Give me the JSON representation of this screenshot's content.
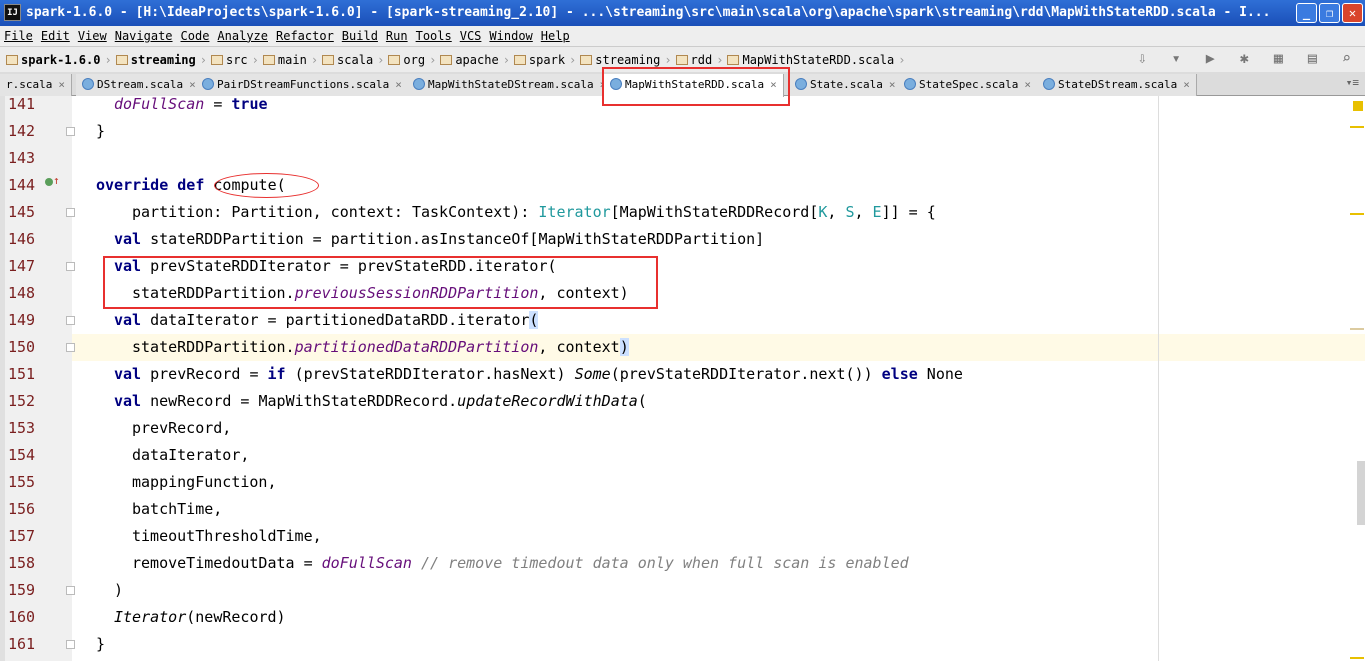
{
  "window": {
    "title": "spark-1.6.0 - [H:\\IdeaProjects\\spark-1.6.0] - [spark-streaming_2.10] - ...\\streaming\\src\\main\\scala\\org\\apache\\spark\\streaming\\rdd\\MapWithStateRDD.scala - I...",
    "app_icon": "IJ",
    "minimize": "_",
    "restore": "❐",
    "close": "✕"
  },
  "menu": [
    "File",
    "Edit",
    "View",
    "Navigate",
    "Code",
    "Analyze",
    "Refactor",
    "Build",
    "Run",
    "Tools",
    "VCS",
    "Window",
    "Help"
  ],
  "breadcrumb": [
    "spark-1.6.0",
    "streaming",
    "src",
    "main",
    "scala",
    "org",
    "apache",
    "spark",
    "streaming",
    "rdd",
    "MapWithStateRDD.scala"
  ],
  "toolbar_icons": [
    "make-icon",
    "run-config-dropdown-icon",
    "run-icon",
    "debug-icon",
    "coverage-icon",
    "project-structure-icon",
    "search-icon"
  ],
  "toolbar_glyphs": "⇩ ▾ ▶ ✱ ▦ ▤ ⌕",
  "tabs": [
    {
      "label": "r.scala",
      "active": false
    },
    {
      "label": "DStream.scala",
      "active": false
    },
    {
      "label": "PairDStreamFunctions.scala",
      "active": false
    },
    {
      "label": "MapWithStateDStream.scala",
      "active": false
    },
    {
      "label": "MapWithStateRDD.scala",
      "active": true
    },
    {
      "label": "State.scala",
      "active": false
    },
    {
      "label": "StateSpec.scala",
      "active": false
    },
    {
      "label": "StateDStream.scala",
      "active": false
    }
  ],
  "tab_close": "×",
  "tab_overflow": "▾≡",
  "current_line": 150,
  "code": [
    {
      "n": "141",
      "ind": 2,
      "tok": [
        [
          "doFullScan",
          "f"
        ],
        [
          " = ",
          ""
        ],
        [
          "true",
          "k"
        ]
      ]
    },
    {
      "n": "142",
      "ind": 0,
      "tok": [
        [
          "}",
          ""
        ]
      ]
    },
    {
      "n": "143",
      "ind": 0,
      "tok": []
    },
    {
      "n": "144",
      "ind": 0,
      "tok": [
        [
          "override def",
          "k"
        ],
        [
          " compute(",
          ""
        ]
      ]
    },
    {
      "n": "145",
      "ind": 4,
      "tok": [
        [
          "partition: Partition, context: TaskContext): ",
          ""
        ],
        [
          "Iterator",
          "t"
        ],
        [
          "[MapWithStateRDDRecord[",
          ""
        ],
        [
          "K",
          "t"
        ],
        [
          ", ",
          ""
        ],
        [
          "S",
          "t"
        ],
        [
          ", ",
          ""
        ],
        [
          "E",
          "t"
        ],
        [
          "]] = {",
          ""
        ]
      ]
    },
    {
      "n": "146",
      "ind": 2,
      "tok": [
        [
          "val",
          "k"
        ],
        [
          " stateRDDPartition = partition.asInstanceOf[MapWithStateRDDPartition]",
          ""
        ]
      ]
    },
    {
      "n": "147",
      "ind": 2,
      "tok": [
        [
          "val",
          "k"
        ],
        [
          " prevStateRDDIterator = prevStateRDD.iterator(",
          ""
        ]
      ]
    },
    {
      "n": "148",
      "ind": 4,
      "tok": [
        [
          "stateRDDPartition.",
          ""
        ],
        [
          "previousSessionRDDPartition",
          "f"
        ],
        [
          ", context)",
          ""
        ]
      ]
    },
    {
      "n": "149",
      "ind": 2,
      "tok": [
        [
          "val",
          "k"
        ],
        [
          " dataIterator = partitionedDataRDD.iterator",
          ""
        ],
        [
          "(",
          "bm"
        ]
      ]
    },
    {
      "n": "150",
      "ind": 4,
      "tok": [
        [
          "stateRDDPartition.",
          ""
        ],
        [
          "partitionedDataRDDPartition",
          "f"
        ],
        [
          ", context",
          ""
        ],
        [
          ")",
          "bm"
        ]
      ]
    },
    {
      "n": "151",
      "ind": 2,
      "tok": [
        [
          "val",
          "k"
        ],
        [
          " prevRecord = ",
          ""
        ],
        [
          "if",
          "k"
        ],
        [
          " (prevStateRDDIterator.hasNext) ",
          ""
        ],
        [
          "Some",
          "i"
        ],
        [
          "(prevStateRDDIterator.next()) ",
          ""
        ],
        [
          "else",
          "k"
        ],
        [
          " None",
          ""
        ]
      ]
    },
    {
      "n": "152",
      "ind": 2,
      "tok": [
        [
          "val",
          "k"
        ],
        [
          " newRecord = MapWithStateRDDRecord.",
          ""
        ],
        [
          "updateRecordWithData",
          "i"
        ],
        [
          "(",
          ""
        ]
      ]
    },
    {
      "n": "153",
      "ind": 4,
      "tok": [
        [
          "prevRecord,",
          ""
        ]
      ]
    },
    {
      "n": "154",
      "ind": 4,
      "tok": [
        [
          "dataIterator,",
          ""
        ]
      ]
    },
    {
      "n": "155",
      "ind": 4,
      "tok": [
        [
          "mappingFunction,",
          ""
        ]
      ]
    },
    {
      "n": "156",
      "ind": 4,
      "tok": [
        [
          "batchTime,",
          ""
        ]
      ]
    },
    {
      "n": "157",
      "ind": 4,
      "tok": [
        [
          "timeoutThresholdTime,",
          ""
        ]
      ]
    },
    {
      "n": "158",
      "ind": 4,
      "tok": [
        [
          "removeTimedoutData = ",
          ""
        ],
        [
          "doFullScan",
          "f"
        ],
        [
          " // remove timedout data only when full scan is enabled",
          "c"
        ]
      ]
    },
    {
      "n": "159",
      "ind": 2,
      "tok": [
        [
          ")",
          ""
        ]
      ]
    },
    {
      "n": "160",
      "ind": 2,
      "tok": [
        [
          "Iterator",
          "i"
        ],
        [
          "(newRecord)",
          ""
        ]
      ]
    },
    {
      "n": "161",
      "ind": 0,
      "tok": [
        [
          "}",
          ""
        ]
      ]
    }
  ],
  "colors": {
    "annotation": "#e8302f",
    "keyword": "#000080",
    "field": "#660e7a",
    "comment": "#808080",
    "current_line": "#fffae6"
  }
}
